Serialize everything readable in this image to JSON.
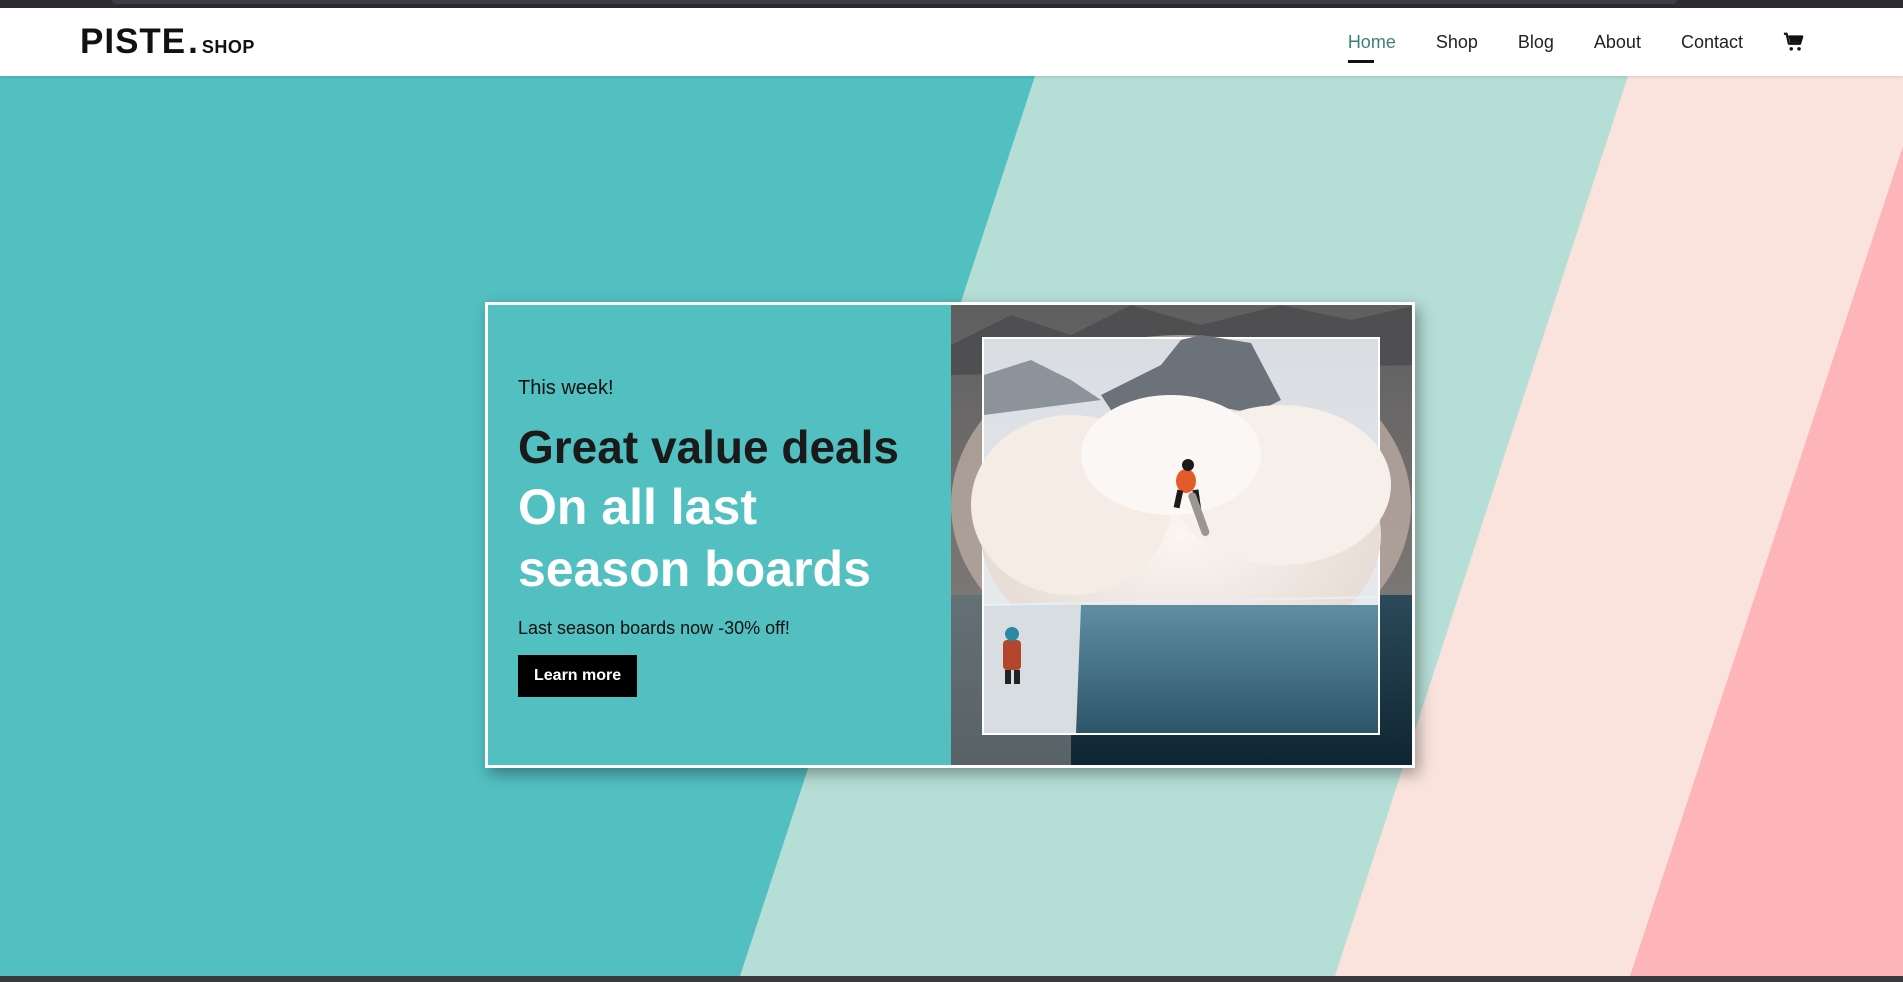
{
  "brand": {
    "name": "PISTE",
    "dot": ".",
    "suffix": "SHOP"
  },
  "nav": {
    "items": [
      {
        "label": "Home",
        "active": true
      },
      {
        "label": "Shop"
      },
      {
        "label": "Blog"
      },
      {
        "label": "About"
      },
      {
        "label": "Contact"
      }
    ],
    "cart_icon": "shopping-cart-icon"
  },
  "hero": {
    "eyebrow": "This week!",
    "headline": "Great value deals",
    "subheadline": "On all last season boards",
    "description": "Last season boards now -30% off!",
    "cta_label": "Learn more",
    "image": "snowboarder-jump-photo"
  },
  "colors": {
    "teal": "#52bfc1",
    "mint": "#b5ded6",
    "peach": "#f9e3dc",
    "pink": "#fdb5b9",
    "white": "#ffffff",
    "black": "#000000"
  }
}
